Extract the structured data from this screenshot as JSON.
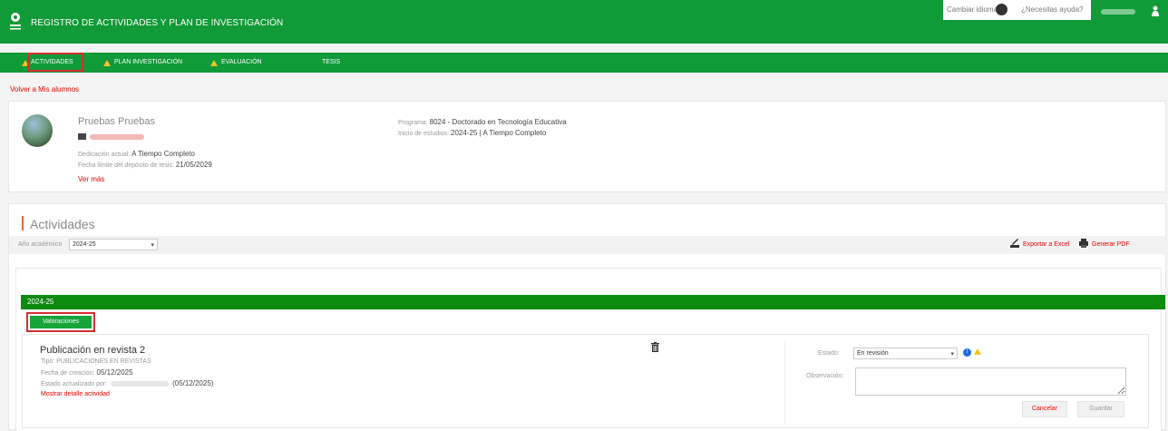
{
  "header": {
    "title": "REGISTRO DE ACTIVIDADES Y PLAN DE INVESTIGACIÓN",
    "change_language": "Cambiar idioma",
    "help": "¿Necesitas ayuda?",
    "logo_icon": "university-logo-icon",
    "user_icon": "user-icon"
  },
  "nav": {
    "items": [
      {
        "label": "ACTIVIDADES",
        "warning": true,
        "selected": true
      },
      {
        "label": "PLAN INVESTIGACIÓN",
        "warning": true
      },
      {
        "label": "EVALUACIÓN",
        "warning": true
      },
      {
        "label": "TESIS",
        "warning": false
      }
    ]
  },
  "back_link": "Volver a Mis alumnos",
  "student": {
    "name": "Pruebas Pruebas",
    "dedicacion_label": "Dedicación actual:",
    "dedicacion_value": "A Tiempo Completo",
    "fecha_limite_label": "Fecha límite del depósito de tesis:",
    "fecha_limite_value": "21/05/2029",
    "ver_mas": "Ver más",
    "programa_label": "Programa:",
    "programa_value": "8024 - Doctorado en Tecnología Educativa",
    "inicio_label": "Inicio de estudios:",
    "inicio_value": "2024-25 | A Tiempo Completo"
  },
  "actividades": {
    "title": "Actividades",
    "year_label": "Año académico",
    "year_value": "2024-25",
    "export_excel": "Exportar a Excel",
    "generate_pdf": "Generar PDF",
    "year_band": "2024-25",
    "valoraciones_button": "Valoraciones"
  },
  "activity": {
    "name": "Publicación en revista 2",
    "tipo_label": "Tipo:",
    "tipo_value": "PUBLICACIONES EN REVISTAS",
    "fecha_label": "Fecha de creación:",
    "fecha_value": "05/12/2025",
    "estado_act_label": "Estado actualizado por:",
    "estado_act_date": "(05/12/2025)",
    "detail_link": "Mostrar detalle actividad",
    "estado_label": "Estado:",
    "estado_value": "En revisión",
    "observacion_label": "Observación:",
    "cancel": "Cancelar",
    "save": "Guardar"
  },
  "colors": {
    "brand_green": "#119a38",
    "link_red": "#e00000",
    "highlight_red": "#d32f2f",
    "warning_yellow": "#f3c323"
  }
}
